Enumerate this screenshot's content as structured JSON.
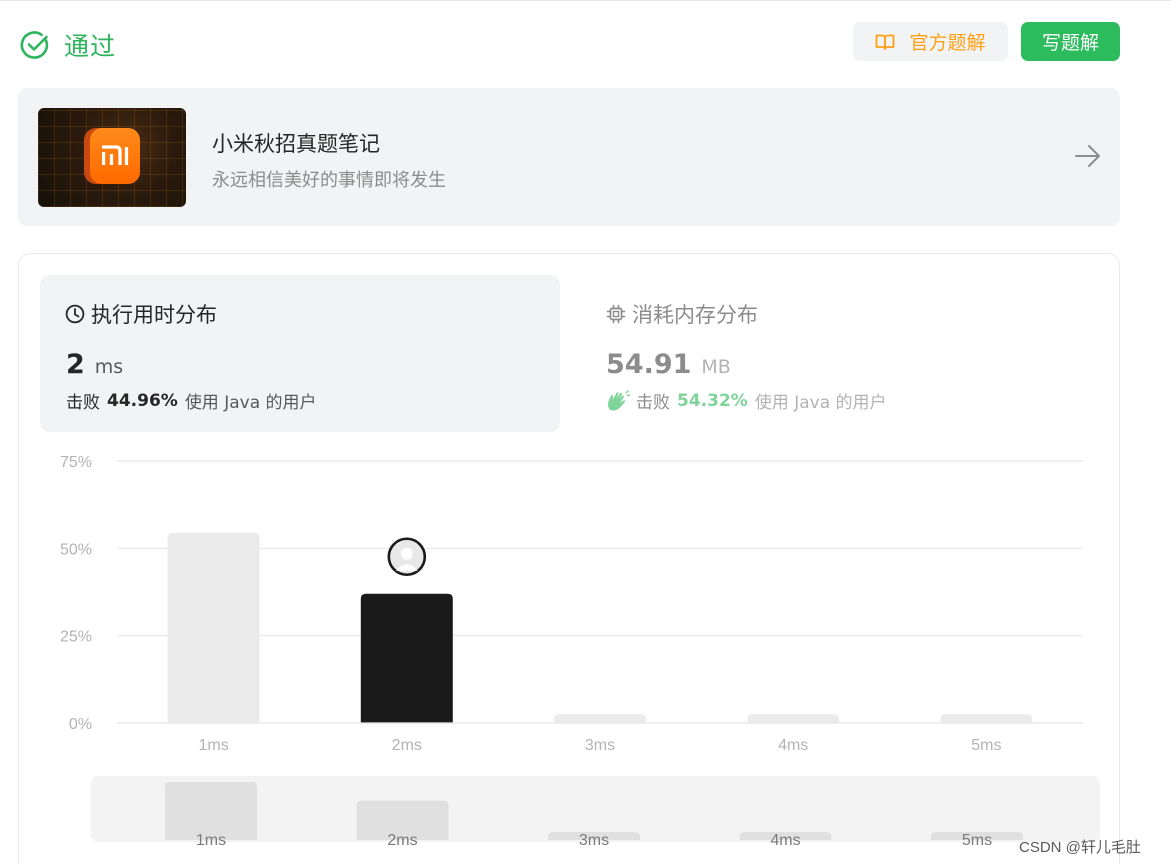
{
  "header": {
    "status_label": "通过",
    "official_solution_label": "官方题解",
    "write_solution_label": "写题解"
  },
  "study_plan": {
    "title": "小米秋招真题笔记",
    "subtitle": "永远相信美好的事情即将发生",
    "logo_text": "mi"
  },
  "runtime": {
    "tab_label": "执行用时分布",
    "value": "2",
    "unit": "ms",
    "beat_prefix": "击败",
    "beat_percent": "44.96%",
    "beat_suffix": "使用 Java 的用户"
  },
  "memory": {
    "tab_label": "消耗内存分布",
    "value": "54.91",
    "unit": "MB",
    "beat_prefix": "击败",
    "beat_percent": "54.32%",
    "beat_suffix": "使用 Java 的用户"
  },
  "chart_data": {
    "type": "bar",
    "categories": [
      "1ms",
      "2ms",
      "3ms",
      "4ms",
      "5ms"
    ],
    "values": [
      54.5,
      37,
      2.5,
      2.5,
      2.5
    ],
    "highlight_category": "2ms",
    "yticks": [
      "0%",
      "25%",
      "50%",
      "75%"
    ],
    "ylim": [
      0,
      75
    ],
    "grid": true,
    "overview": {
      "categories": [
        "1ms",
        "2ms",
        "3ms",
        "4ms",
        "5ms"
      ],
      "values": [
        54.5,
        37,
        2.5,
        2.5,
        2.5
      ]
    }
  },
  "colors": {
    "accent_green": "#2cbb5d",
    "accent_orange": "#ffa116",
    "bar_default": "#ebebeb",
    "bar_highlight": "#1a1a1a"
  },
  "watermark": "CSDN @轩儿毛肚"
}
